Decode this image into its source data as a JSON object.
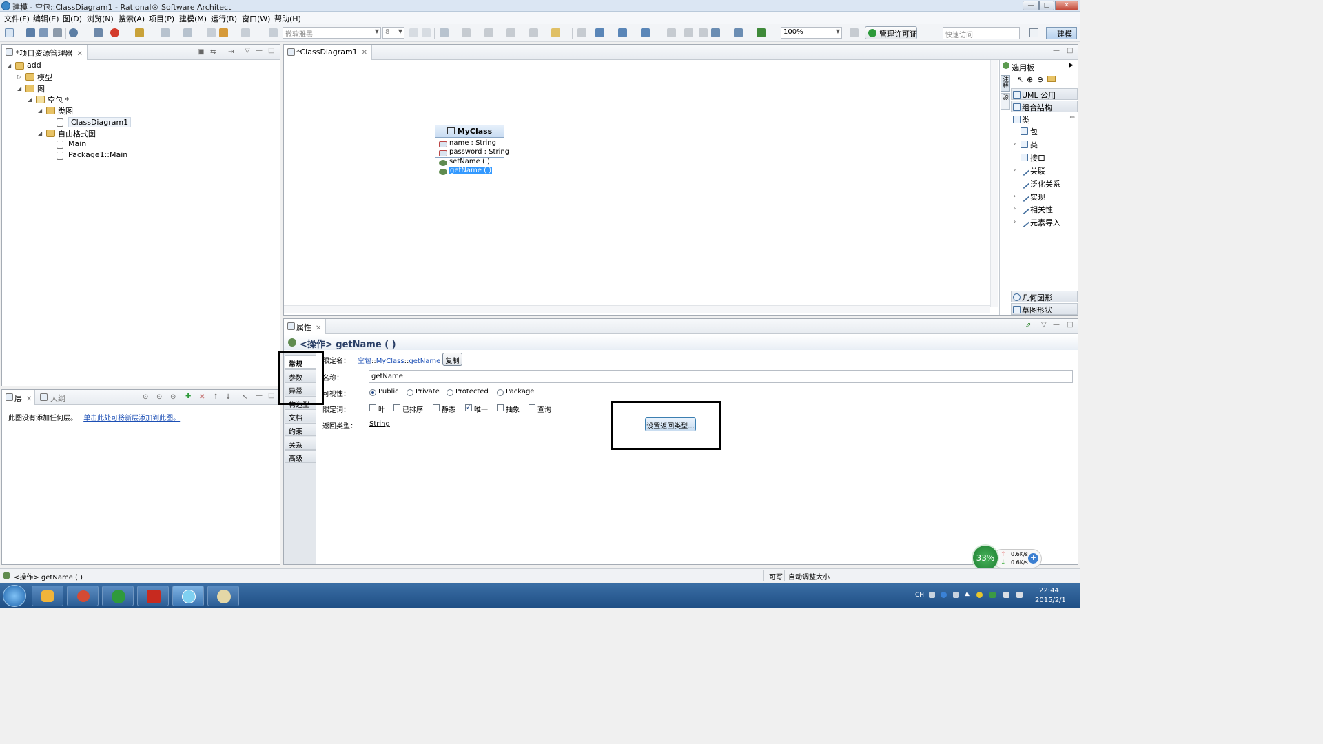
{
  "window": {
    "title": "建模 - 空包::ClassDiagram1 - Rational® Software Architect",
    "buttons": [
      "—",
      "□",
      "✕"
    ]
  },
  "menu": [
    "文件(F)",
    "编辑(E)",
    "图(D)",
    "浏览(N)",
    "搜索(A)",
    "项目(P)",
    "建模(M)",
    "运行(R)",
    "窗口(W)",
    "帮助(H)"
  ],
  "toolbar": {
    "font_combo": "微软雅黑",
    "size_combo": "8",
    "zoom_combo": "100%",
    "license_button": "管理许可证",
    "quick_access": "快速访问",
    "perspective_button": "建模"
  },
  "project_explorer": {
    "tab_label": "*项目资源管理器",
    "tree": [
      {
        "label": "add",
        "level": 0,
        "twisty": "◢",
        "icon": "project-icon"
      },
      {
        "label": "模型",
        "level": 1,
        "twisty": "▷",
        "icon": "model-folder-icon"
      },
      {
        "label": "图",
        "level": 1,
        "twisty": "◢",
        "icon": "diagram-folder-icon"
      },
      {
        "label": "空包 *",
        "level": 2,
        "twisty": "◢",
        "icon": "package-icon"
      },
      {
        "label": "类图",
        "level": 3,
        "twisty": "◢",
        "icon": "class-diagram-folder-icon"
      },
      {
        "label": "ClassDiagram1",
        "level": 4,
        "twisty": "",
        "icon": "diagram-file-icon"
      },
      {
        "label": "自由格式图",
        "level": 3,
        "twisty": "◢",
        "icon": "freeform-folder-icon"
      },
      {
        "label": "Main",
        "level": 4,
        "twisty": "",
        "icon": "document-icon"
      },
      {
        "label": "Package1::Main",
        "level": 4,
        "twisty": "",
        "icon": "document-icon"
      }
    ]
  },
  "layers_panel": {
    "tab_layers": "层",
    "tab_outline": "大纲",
    "message": "此图没有添加任何层。",
    "link": "单击此处可将新层添加到此图。"
  },
  "editor": {
    "tab_label": "*ClassDiagram1",
    "class_box": {
      "name": "MyClass",
      "attributes": [
        "name : String",
        "password : String"
      ],
      "operations": [
        "setName ( )",
        "getName ( )"
      ]
    }
  },
  "palette": {
    "title": "选用板",
    "side_tabs": [
      "注释",
      "源"
    ],
    "drawers": [
      "UML 公用",
      "组合结构",
      "类"
    ],
    "items": [
      "包",
      "类",
      "接口",
      "关联",
      "泛化关系",
      "实现",
      "相关性",
      "元素导入"
    ],
    "bottom_drawers": [
      "几何图形",
      "草图形状"
    ]
  },
  "properties": {
    "tab_label": "属性",
    "header": "<操作> getName ( )",
    "side_tabs": [
      "常规",
      "参数",
      "异常",
      "构造型",
      "文档",
      "约束",
      "关系",
      "高级"
    ],
    "qualified_name_label": "限定名：",
    "qualified_name_parts": [
      "空包",
      "::",
      "MyClass",
      "::",
      "getName"
    ],
    "copy_button": "复制",
    "name_label": "名称：",
    "name_value": "getName",
    "visibility_label": "可视性：",
    "visibility_options": [
      "Public",
      "Private",
      "Protected",
      "Package"
    ],
    "visibility_selected": "Public",
    "qualifiers_label": "限定词：",
    "qualifiers": [
      {
        "label": "叶",
        "checked": false
      },
      {
        "label": "已排序",
        "checked": false
      },
      {
        "label": "静态",
        "checked": false
      },
      {
        "label": "唯一",
        "checked": true
      },
      {
        "label": "抽象",
        "checked": false
      },
      {
        "label": "查询",
        "checked": false
      }
    ],
    "return_type_label": "返回类型：",
    "return_type_value": "String",
    "set_return_type_button": "设置返回类型..."
  },
  "status_bar": {
    "left": "<操作> getName ( )",
    "writable": "可写",
    "auto_resize": "自动调整大小"
  },
  "network_widget": {
    "percent": "33%",
    "up": "0.6K/s",
    "down": "0.6K/s"
  },
  "taskbar": {
    "lang": "CH",
    "time": "22:44",
    "date": "2015/2/1"
  },
  "colors": {
    "selection": "#3399ff",
    "link": "#1c4fb5",
    "highlight_box": "#000000",
    "taskbar": "#2a5b92"
  }
}
